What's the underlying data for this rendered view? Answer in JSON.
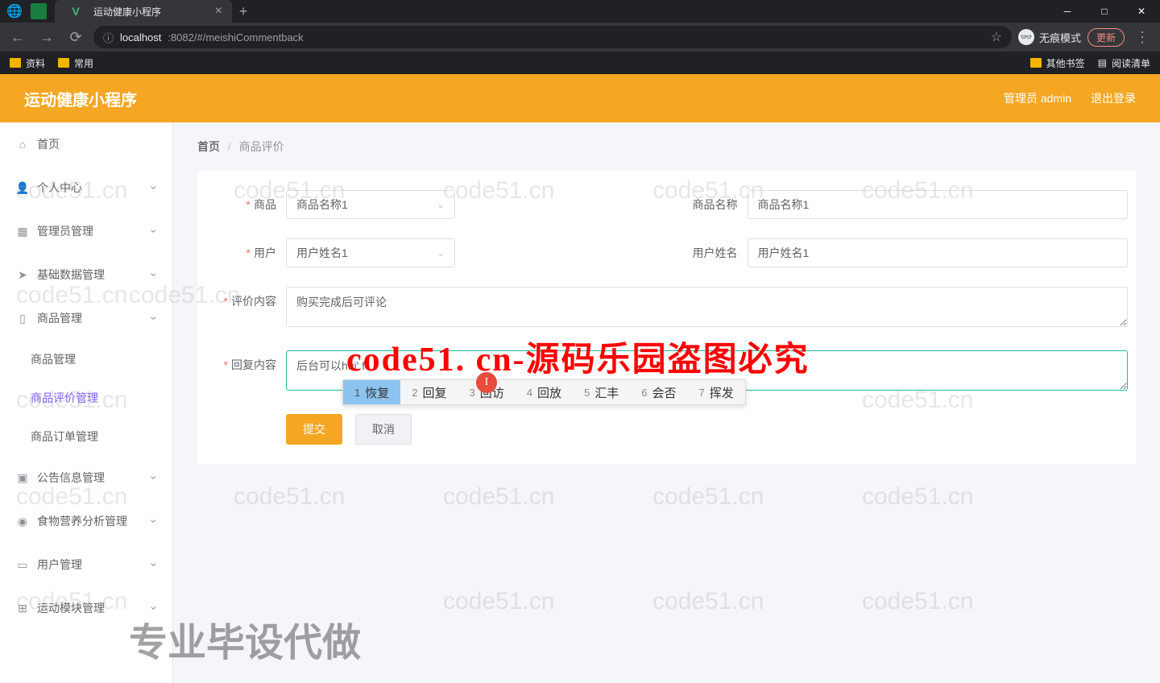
{
  "browser": {
    "tab_title": "运动健康小程序",
    "url_host": "localhost",
    "url_path": ":8082/#/meishiCommentback",
    "incognito": "无痕模式",
    "update": "更新",
    "bookmarks": {
      "zl": "资料",
      "cy": "常用",
      "other": "其他书签",
      "reading": "阅读清单"
    },
    "window": {
      "min": "─",
      "max": "□",
      "close": "✕"
    }
  },
  "header": {
    "title": "运动健康小程序",
    "admin": "管理员 admin",
    "logout": "退出登录"
  },
  "sidebar": {
    "home": "首页",
    "personal": "个人中心",
    "admin_mgmt": "管理员管理",
    "base_data": "基础数据管理",
    "product_mgmt": "商品管理",
    "sub_product": "商品管理",
    "sub_comment": "商品评价管理",
    "sub_order": "商品订单管理",
    "notice": "公告信息管理",
    "food": "食物营养分析管理",
    "user": "用户管理",
    "sport": "运动模块管理"
  },
  "breadcrumb": {
    "home": "首页",
    "current": "商品评价"
  },
  "form": {
    "product_label": "商品",
    "product_select": "商品名称1",
    "product_name_label": "商品名称",
    "product_name_value": "商品名称1",
    "user_label": "用户",
    "user_select": "用户姓名1",
    "user_name_label": "用户姓名",
    "user_name_value": "用户姓名1",
    "comment_label": "评价内容",
    "comment_value": "购买完成后可评论",
    "reply_label": "回复内容",
    "reply_value": "后台可以hui' f",
    "submit": "提交",
    "cancel": "取消"
  },
  "ime": [
    {
      "n": "1",
      "t": "恢复"
    },
    {
      "n": "2",
      "t": "回复"
    },
    {
      "n": "3",
      "t": "回访"
    },
    {
      "n": "4",
      "t": "回放"
    },
    {
      "n": "5",
      "t": "汇丰"
    },
    {
      "n": "6",
      "t": "会否"
    },
    {
      "n": "7",
      "t": "挥发"
    }
  ],
  "watermark": {
    "red": "code51. cn-源码乐园盗图必究",
    "gray": "专业毕设代做",
    "bg": "code51.cn"
  }
}
